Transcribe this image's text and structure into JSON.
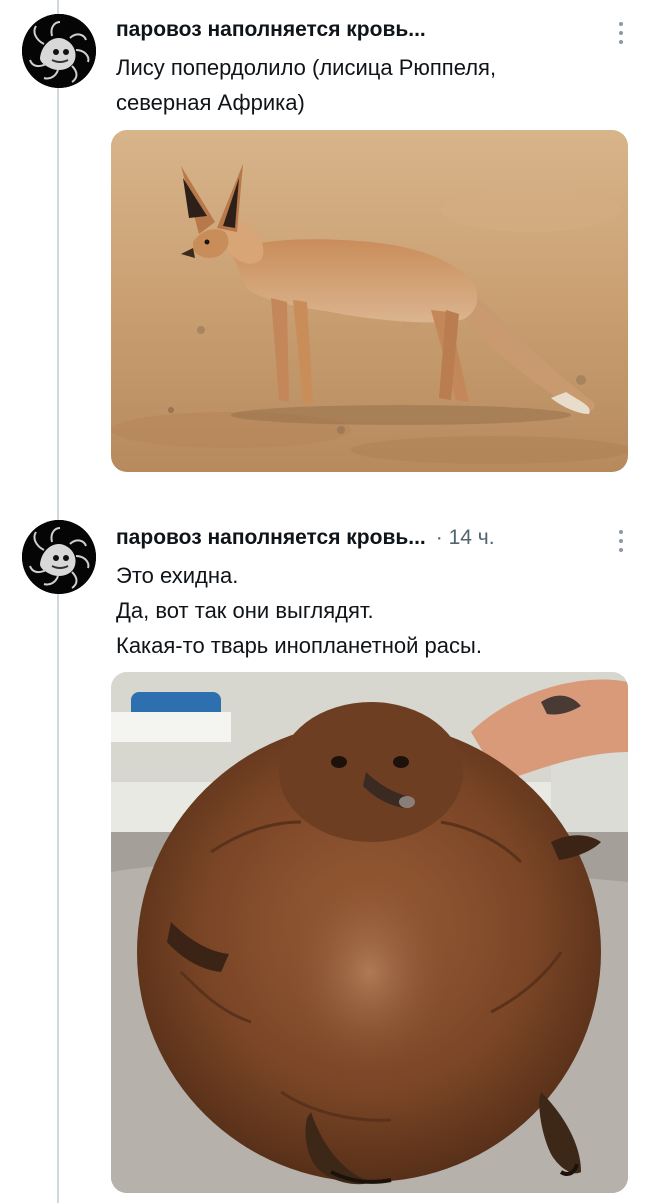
{
  "posts": [
    {
      "author": "паровоз наполняется кровь...",
      "time": "",
      "text_lines": [
        "Лису попердолило (лисица Рюппеля,",
        "северная Африка)"
      ],
      "media": "fox-photo"
    },
    {
      "author": "паровоз наполняется кровь...",
      "time": "· 14 ч.",
      "text_lines": [
        "Это ехидна.",
        "Да, вот так они выглядят.",
        "Какая-то тварь инопланетной расы."
      ],
      "media": "echidna-photo"
    }
  ],
  "icons": {
    "avatar": "ghost-creature-avatar",
    "menu": "vertical-ellipsis-icon"
  },
  "colors": {
    "text": "#0f1419",
    "muted": "#536471",
    "thread_line": "#cfd9de"
  }
}
